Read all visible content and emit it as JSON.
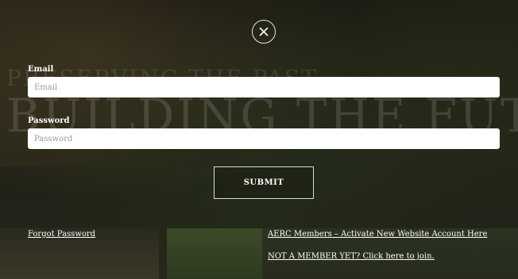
{
  "background": {
    "headline_small": "PRESERVING THE PAST",
    "headline_big": "BUILDING THE FUTURE"
  },
  "modal": {
    "close_icon": "close-icon",
    "email": {
      "label": "Email",
      "placeholder": "Email",
      "value": ""
    },
    "password": {
      "label": "Password",
      "placeholder": "Password",
      "value": ""
    },
    "submit_label": "SUBMIT",
    "links": {
      "forgot_password": "Forgot Password",
      "activate_account": "AERC Members – Activate New Website Account Here",
      "join": "NOT A MEMBER YET? Click here to join."
    }
  },
  "colors": {
    "overlay": "#1a1a16",
    "text": "#ffffff",
    "input_bg": "#ffffff",
    "button_border": "#d9d9d9"
  }
}
